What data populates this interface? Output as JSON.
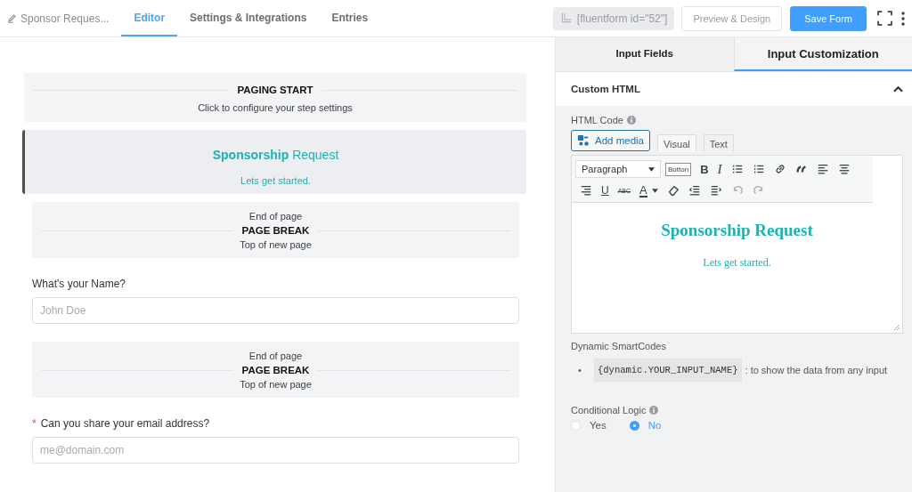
{
  "header": {
    "form_name": "Sponsor Reques...",
    "tabs": [
      {
        "label": "Editor",
        "selected": true
      },
      {
        "label": "Settings & Integrations",
        "selected": false
      },
      {
        "label": "Entries",
        "selected": false
      }
    ],
    "shortcode": "[fluentform id=\"52\"]",
    "preview_button": "Preview & Design",
    "save_button": "Save Form"
  },
  "canvas": {
    "items": [
      {
        "kind": "paging_start",
        "title": "PAGING START",
        "subtitle": "Click to configure your step settings"
      },
      {
        "kind": "html",
        "selected": true,
        "heading": "**Sponsorship** Request",
        "text": "Lets get started."
      },
      {
        "kind": "page_break",
        "top": "End of page",
        "title": "PAGE BREAK",
        "bottom": "Top of new page"
      },
      {
        "kind": "text_input",
        "label": "What's your Name?",
        "required": false,
        "placeholder": "John Doe"
      },
      {
        "kind": "page_break",
        "top": "End of page",
        "title": "PAGE BREAK",
        "bottom": "Top of new page"
      },
      {
        "kind": "text_input",
        "label": "Can you share your email address?",
        "required": true,
        "required_mark": "*",
        "placeholder": "me@domain.com"
      }
    ]
  },
  "panel": {
    "tabs": [
      {
        "label": "Input Fields",
        "selected": false
      },
      {
        "label": "Input Customization",
        "selected": true
      }
    ],
    "section": {
      "title": "Custom HTML",
      "expanded": true
    },
    "html_code_label": "HTML Code",
    "add_media": "Add media",
    "editor_tabs": [
      {
        "label": "Visual",
        "selected": true
      },
      {
        "label": "Text",
        "selected": false
      }
    ],
    "format_select": "Paragraph",
    "toolbar": [
      {
        "kind": "button",
        "text": "Button",
        "disabled": false
      },
      {
        "kind": "bold",
        "text": "B",
        "disabled": false
      },
      {
        "kind": "italic",
        "text": "I",
        "disabled": false
      },
      {
        "kind": "bullet-list",
        "disabled": false
      },
      {
        "kind": "numbered-list",
        "disabled": false
      },
      {
        "kind": "link",
        "disabled": false
      },
      {
        "kind": "quote",
        "disabled": false
      },
      {
        "kind": "align-left",
        "disabled": false
      },
      {
        "kind": "align-center",
        "disabled": false
      },
      {
        "kind": "align-right",
        "disabled": false
      },
      {
        "kind": "underline",
        "text": "U",
        "disabled": false
      },
      {
        "kind": "strike",
        "text": "ABC",
        "disabled": false
      },
      {
        "kind": "text-color",
        "text": "A",
        "disabled": false
      },
      {
        "kind": "eraser",
        "disabled": false
      },
      {
        "kind": "outdent",
        "disabled": false
      },
      {
        "kind": "indent",
        "disabled": false
      },
      {
        "kind": "undo",
        "disabled": true
      },
      {
        "kind": "redo",
        "disabled": true
      }
    ],
    "content_heading": "Sponsorship Request",
    "content_text": "Lets get started.",
    "smartcodes_label": "Dynamic SmartCodes",
    "smartcodes": [
      {
        "marker": "•",
        "code": "{dynamic.YOUR_INPUT_NAME}",
        "text": ": to show the data from any input"
      }
    ],
    "conditional_logic": {
      "label": "Conditional Logic",
      "options": [
        {
          "label": "Yes",
          "selected": false
        },
        {
          "label": "No",
          "selected": true
        }
      ]
    }
  }
}
